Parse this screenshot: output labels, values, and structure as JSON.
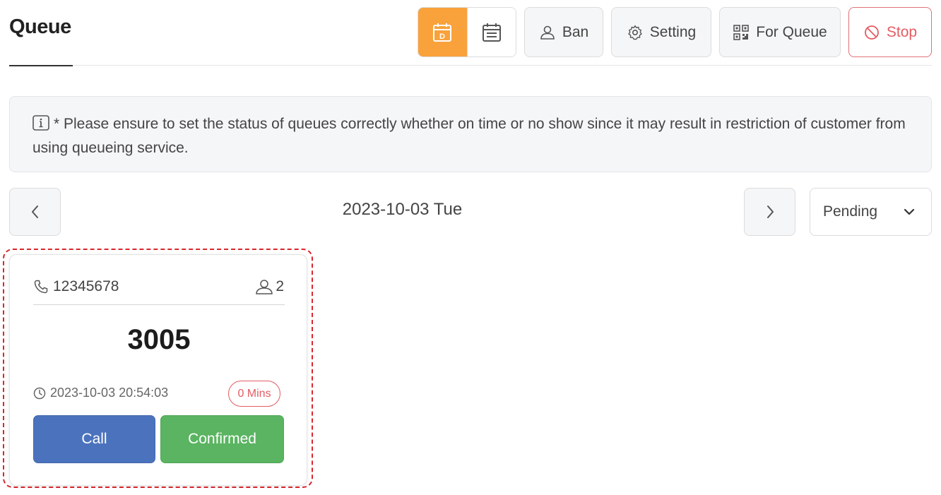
{
  "header": {
    "title": "Queue"
  },
  "toolbar": {
    "day_view_icon": "day-calendar-icon",
    "month_view_icon": "calendar-icon",
    "ban_label": "Ban",
    "setting_label": "Setting",
    "for_queue_label": "For Queue",
    "stop_label": "Stop",
    "day_badge": "D"
  },
  "notice": {
    "text": "* Please ensure to set the status of queues correctly whether on time or no show since it may result in restriction of customer from using queueing service."
  },
  "date_nav": {
    "date": "2023-10-03 Tue"
  },
  "status_filter": {
    "selected": "Pending"
  },
  "queue_cards": [
    {
      "phone": "12345678",
      "party_size": "2",
      "queue_number": "3005",
      "created_at": "2023-10-03 20:54:03",
      "wait_time": "0 Mins",
      "call_label": "Call",
      "confirm_label": "Confirmed"
    }
  ],
  "colors": {
    "accent_orange": "#f9a23b",
    "stop_red": "#e45c63",
    "call_blue": "#4b73bd",
    "confirm_green": "#5ab461",
    "highlight_red": "#d9262c"
  }
}
